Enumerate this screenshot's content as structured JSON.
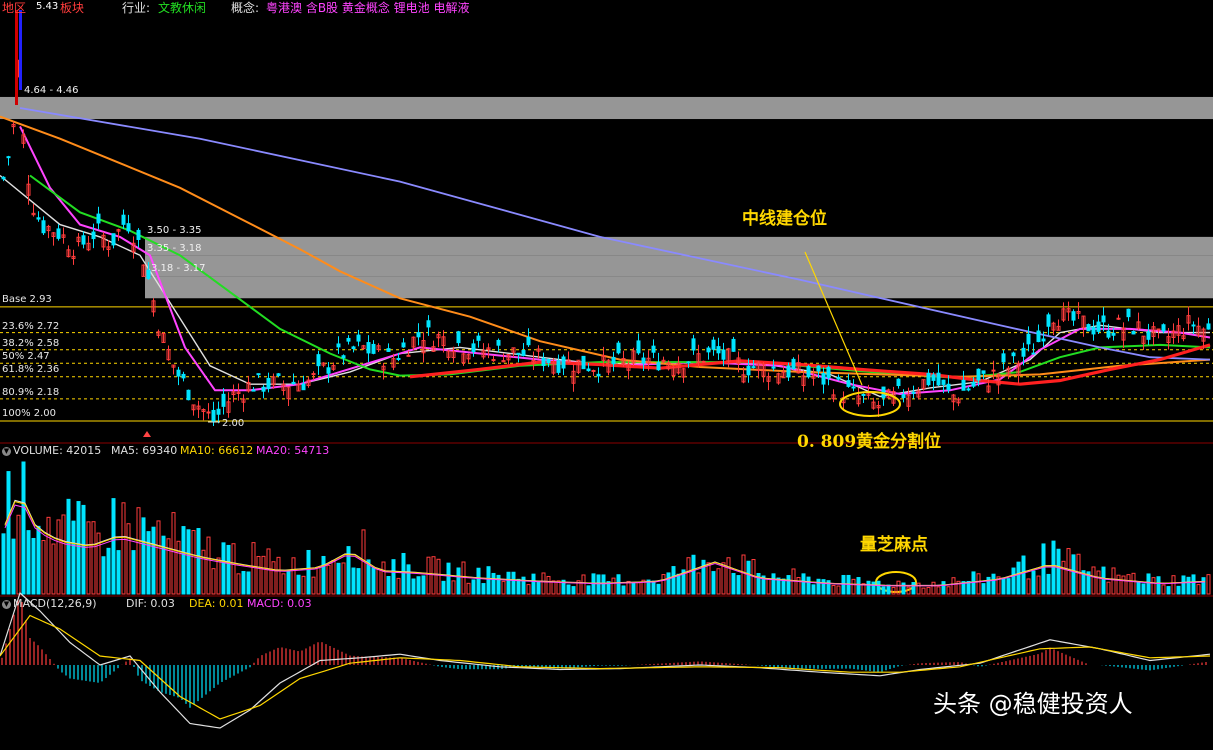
{
  "header": {
    "region_label": "地区",
    "region_value": "5.43",
    "board_text": "板块",
    "industry_label": "行业:",
    "industry_value": "文教休闲",
    "concept_label": "概念:",
    "concept_value": "粤港澳 含B股 黄金概念 锂电池 电解液"
  },
  "price_panel": {
    "zones": [
      {
        "label": "4.64 - 4.46",
        "top": 4.64,
        "bottom": 4.46
      },
      {
        "label": "3.50 - 3.35",
        "top": 3.5,
        "bottom": 3.35
      },
      {
        "label": "3.35 - 3.18",
        "top": 3.35,
        "bottom": 3.18
      },
      {
        "label": "3.18 - 3.17",
        "top": 3.18,
        "bottom": 3.0
      }
    ],
    "fib_levels": [
      {
        "label": "Base 2.93",
        "value": 2.93
      },
      {
        "label": "23.6% 2.72",
        "value": 2.72
      },
      {
        "label": "38.2% 2.58",
        "value": 2.58
      },
      {
        "label": "50% 2.47",
        "value": 2.47
      },
      {
        "label": "61.8% 2.36",
        "value": 2.36
      },
      {
        "label": "80.9% 2.18",
        "value": 2.18
      },
      {
        "label": "100% 2.00",
        "value": 2.0
      }
    ],
    "low_marker": "2.00",
    "high_marker": "5.43",
    "annotations": {
      "midline_position": "中线建仓位",
      "golden_ratio": "0. 809黄金分割位"
    }
  },
  "volume_panel": {
    "title": "VOLUME: 42015",
    "ma5": "MA5: 69340",
    "ma10": "MA10: 66612",
    "ma20": "MA20: 54713",
    "annotation": "量芝麻点"
  },
  "macd_panel": {
    "title": "MACD(12,26,9)",
    "dif": "DIF: 0.03",
    "dea": "DEA: 0.01",
    "macd": "MACD: 0.03"
  },
  "watermark": "头条 @稳健投资人",
  "colors": {
    "up": "#ff3c3c",
    "down": "#00e5ff",
    "ma_white": "#e0e0e0",
    "ma_magenta": "#ff44ff",
    "ma_green": "#22dd22",
    "ma_orange": "#ff8c1a",
    "ma_blue": "#8a8aff",
    "ma_red": "#ff2020",
    "fib_line": "#ffd700",
    "annotation": "#ffd700",
    "zone": "#b0b0b0"
  },
  "chart_data": {
    "type": "candlestick",
    "y_axis_range": [
      1.85,
      5.5
    ],
    "price_path": [
      [
        0,
        3.9
      ],
      [
        8,
        4.2
      ],
      [
        14,
        4.5
      ],
      [
        18,
        5.0
      ],
      [
        22,
        4.3
      ],
      [
        30,
        3.8
      ],
      [
        40,
        3.6
      ],
      [
        55,
        3.55
      ],
      [
        75,
        3.4
      ],
      [
        95,
        3.55
      ],
      [
        110,
        3.45
      ],
      [
        125,
        3.65
      ],
      [
        140,
        3.4
      ],
      [
        160,
        2.7
      ],
      [
        175,
        2.4
      ],
      [
        195,
        2.15
      ],
      [
        212,
        2.0
      ],
      [
        230,
        2.2
      ],
      [
        250,
        2.3
      ],
      [
        280,
        2.3
      ],
      [
        310,
        2.33
      ],
      [
        340,
        2.55
      ],
      [
        360,
        2.6
      ],
      [
        390,
        2.5
      ],
      [
        420,
        2.72
      ],
      [
        450,
        2.65
      ],
      [
        480,
        2.58
      ],
      [
        520,
        2.55
      ],
      [
        560,
        2.48
      ],
      [
        600,
        2.45
      ],
      [
        640,
        2.5
      ],
      [
        680,
        2.5
      ],
      [
        715,
        2.55
      ],
      [
        740,
        2.45
      ],
      [
        780,
        2.42
      ],
      [
        820,
        2.35
      ],
      [
        850,
        2.22
      ],
      [
        875,
        2.12
      ],
      [
        900,
        2.22
      ],
      [
        930,
        2.35
      ],
      [
        950,
        2.2
      ],
      [
        980,
        2.32
      ],
      [
        1010,
        2.45
      ],
      [
        1035,
        2.62
      ],
      [
        1050,
        2.88
      ],
      [
        1070,
        2.82
      ],
      [
        1100,
        2.75
      ],
      [
        1130,
        2.78
      ],
      [
        1160,
        2.65
      ],
      [
        1190,
        2.8
      ],
      [
        1210,
        2.72
      ]
    ],
    "ma_series": [
      {
        "key": "ma_white",
        "points": [
          [
            0,
            4.0
          ],
          [
            30,
            3.8
          ],
          [
            60,
            3.6
          ],
          [
            100,
            3.5
          ],
          [
            140,
            3.35
          ],
          [
            175,
            2.9
          ],
          [
            210,
            2.45
          ],
          [
            250,
            2.3
          ],
          [
            300,
            2.3
          ],
          [
            350,
            2.4
          ],
          [
            400,
            2.55
          ],
          [
            460,
            2.6
          ],
          [
            530,
            2.53
          ],
          [
            600,
            2.46
          ],
          [
            680,
            2.48
          ],
          [
            760,
            2.47
          ],
          [
            830,
            2.38
          ],
          [
            880,
            2.2
          ],
          [
            930,
            2.27
          ],
          [
            980,
            2.32
          ],
          [
            1030,
            2.5
          ],
          [
            1060,
            2.72
          ],
          [
            1100,
            2.78
          ],
          [
            1160,
            2.72
          ],
          [
            1210,
            2.72
          ]
        ]
      },
      {
        "key": "ma_magenta",
        "points": [
          [
            20,
            4.4
          ],
          [
            50,
            3.9
          ],
          [
            80,
            3.6
          ],
          [
            120,
            3.5
          ],
          [
            150,
            3.35
          ],
          [
            185,
            2.6
          ],
          [
            215,
            2.25
          ],
          [
            250,
            2.25
          ],
          [
            300,
            2.3
          ],
          [
            360,
            2.45
          ],
          [
            420,
            2.6
          ],
          [
            480,
            2.55
          ],
          [
            540,
            2.5
          ],
          [
            610,
            2.45
          ],
          [
            700,
            2.48
          ],
          [
            780,
            2.45
          ],
          [
            850,
            2.3
          ],
          [
            900,
            2.22
          ],
          [
            950,
            2.25
          ],
          [
            1000,
            2.34
          ],
          [
            1040,
            2.58
          ],
          [
            1080,
            2.75
          ],
          [
            1130,
            2.75
          ],
          [
            1180,
            2.72
          ],
          [
            1210,
            2.68
          ]
        ]
      },
      {
        "key": "ma_green",
        "points": [
          [
            30,
            4.0
          ],
          [
            80,
            3.7
          ],
          [
            130,
            3.55
          ],
          [
            180,
            3.35
          ],
          [
            230,
            3.05
          ],
          [
            280,
            2.75
          ],
          [
            330,
            2.55
          ],
          [
            370,
            2.42
          ],
          [
            400,
            2.37
          ],
          [
            450,
            2.38
          ],
          [
            520,
            2.45
          ],
          [
            600,
            2.48
          ],
          [
            680,
            2.48
          ],
          [
            760,
            2.48
          ],
          [
            840,
            2.42
          ],
          [
            900,
            2.38
          ],
          [
            960,
            2.35
          ],
          [
            1020,
            2.4
          ],
          [
            1060,
            2.52
          ],
          [
            1100,
            2.6
          ],
          [
            1160,
            2.62
          ],
          [
            1210,
            2.6
          ]
        ]
      },
      {
        "key": "ma_orange",
        "points": [
          [
            0,
            4.48
          ],
          [
            60,
            4.3
          ],
          [
            120,
            4.1
          ],
          [
            180,
            3.9
          ],
          [
            240,
            3.65
          ],
          [
            300,
            3.4
          ],
          [
            340,
            3.22
          ],
          [
            400,
            3.0
          ],
          [
            470,
            2.85
          ],
          [
            540,
            2.65
          ],
          [
            620,
            2.5
          ],
          [
            700,
            2.44
          ],
          [
            800,
            2.4
          ],
          [
            880,
            2.38
          ],
          [
            960,
            2.36
          ],
          [
            1040,
            2.38
          ],
          [
            1120,
            2.45
          ],
          [
            1210,
            2.5
          ]
        ]
      },
      {
        "key": "ma_blue",
        "points": [
          [
            20,
            4.55
          ],
          [
            200,
            4.3
          ],
          [
            400,
            3.95
          ],
          [
            600,
            3.5
          ],
          [
            800,
            3.15
          ],
          [
            1000,
            2.78
          ],
          [
            1100,
            2.6
          ],
          [
            1150,
            2.52
          ],
          [
            1210,
            2.5
          ]
        ]
      },
      {
        "key": "ma_red",
        "points": [
          [
            410,
            2.36
          ],
          [
            480,
            2.42
          ],
          [
            540,
            2.48
          ],
          [
            600,
            2.46
          ],
          [
            660,
            2.43
          ],
          [
            740,
            2.49
          ],
          [
            800,
            2.46
          ],
          [
            860,
            2.42
          ],
          [
            930,
            2.38
          ],
          [
            980,
            2.33
          ],
          [
            1020,
            2.3
          ],
          [
            1060,
            2.33
          ],
          [
            1110,
            2.42
          ],
          [
            1160,
            2.5
          ],
          [
            1210,
            2.62
          ]
        ]
      }
    ],
    "volume_profile": [
      [
        0,
        0.55
      ],
      [
        10,
        0.75
      ],
      [
        20,
        1.0
      ],
      [
        30,
        0.7
      ],
      [
        40,
        0.6
      ],
      [
        60,
        0.5
      ],
      [
        90,
        0.45
      ],
      [
        120,
        0.55
      ],
      [
        160,
        0.45
      ],
      [
        200,
        0.35
      ],
      [
        240,
        0.28
      ],
      [
        280,
        0.22
      ],
      [
        320,
        0.25
      ],
      [
        350,
        0.4
      ],
      [
        380,
        0.22
      ],
      [
        420,
        0.2
      ],
      [
        480,
        0.15
      ],
      [
        540,
        0.12
      ],
      [
        600,
        0.1
      ],
      [
        660,
        0.12
      ],
      [
        715,
        0.3
      ],
      [
        760,
        0.15
      ],
      [
        830,
        0.1
      ],
      [
        890,
        0.08
      ],
      [
        940,
        0.08
      ],
      [
        1000,
        0.14
      ],
      [
        1050,
        0.28
      ],
      [
        1100,
        0.15
      ],
      [
        1160,
        0.1
      ],
      [
        1210,
        0.12
      ]
    ],
    "dif_path": [
      [
        0,
        0.1
      ],
      [
        20,
        0.8
      ],
      [
        40,
        0.6
      ],
      [
        70,
        0.25
      ],
      [
        100,
        0.0
      ],
      [
        130,
        0.1
      ],
      [
        160,
        -0.3
      ],
      [
        190,
        -0.65
      ],
      [
        220,
        -0.7
      ],
      [
        250,
        -0.5
      ],
      [
        280,
        -0.2
      ],
      [
        320,
        0.05
      ],
      [
        360,
        0.08
      ],
      [
        400,
        0.12
      ],
      [
        440,
        0.05
      ],
      [
        500,
        -0.02
      ],
      [
        560,
        -0.05
      ],
      [
        620,
        -0.04
      ],
      [
        700,
        0.0
      ],
      [
        760,
        -0.03
      ],
      [
        820,
        -0.08
      ],
      [
        880,
        -0.12
      ],
      [
        920,
        -0.05
      ],
      [
        980,
        0.02
      ],
      [
        1050,
        0.28
      ],
      [
        1100,
        0.18
      ],
      [
        1150,
        0.05
      ],
      [
        1210,
        0.12
      ]
    ],
    "dea_path": [
      [
        0,
        0.1
      ],
      [
        30,
        0.55
      ],
      [
        60,
        0.4
      ],
      [
        100,
        0.1
      ],
      [
        140,
        0.05
      ],
      [
        180,
        -0.35
      ],
      [
        220,
        -0.6
      ],
      [
        260,
        -0.45
      ],
      [
        300,
        -0.15
      ],
      [
        350,
        0.02
      ],
      [
        400,
        0.08
      ],
      [
        460,
        0.05
      ],
      [
        520,
        -0.02
      ],
      [
        600,
        -0.04
      ],
      [
        700,
        -0.02
      ],
      [
        780,
        -0.03
      ],
      [
        850,
        -0.08
      ],
      [
        900,
        -0.08
      ],
      [
        960,
        -0.02
      ],
      [
        1040,
        0.18
      ],
      [
        1090,
        0.2
      ],
      [
        1150,
        0.08
      ],
      [
        1210,
        0.1
      ]
    ]
  }
}
